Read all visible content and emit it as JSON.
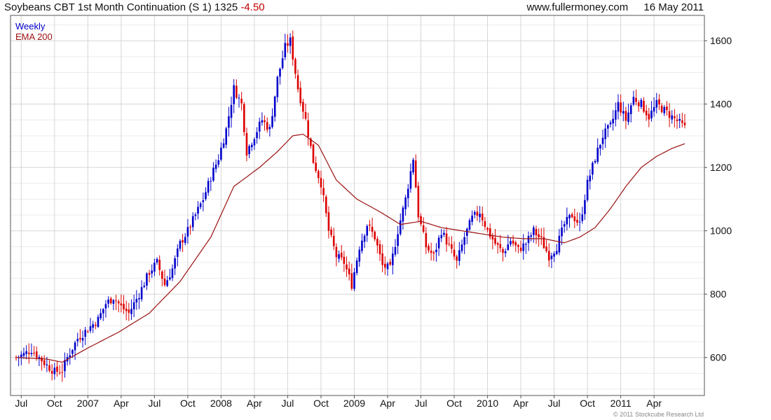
{
  "header": {
    "title": "Soybeans CBT 1st Month Continuation (S 1) 1325",
    "change": "-4.50",
    "site": "www.fullermoney.com",
    "date": "16 May 2011"
  },
  "footer": {
    "copyright": "© 2011 Stockcube Research Ltd"
  },
  "colors": {
    "up": "#0000cc",
    "down": "#dd0000",
    "ema": "#9b1010",
    "grid": "#d6d6d6",
    "grid_minor": "#ececec",
    "frame": "#555555"
  },
  "chart_data": {
    "type": "candlestick",
    "legend": [
      "Weekly",
      "EMA 200"
    ],
    "ylim": [
      480,
      1680
    ],
    "y_ticks": [
      600,
      800,
      1000,
      1200,
      1400,
      1600
    ],
    "x_ticks": [
      {
        "label": "Jul",
        "week": 2
      },
      {
        "label": "Oct",
        "week": 15
      },
      {
        "label": "2007",
        "week": 28
      },
      {
        "label": "Apr",
        "week": 41
      },
      {
        "label": "Jul",
        "week": 54
      },
      {
        "label": "Oct",
        "week": 67
      },
      {
        "label": "2008",
        "week": 80
      },
      {
        "label": "Apr",
        "week": 93
      },
      {
        "label": "Jul",
        "week": 106
      },
      {
        "label": "Oct",
        "week": 119
      },
      {
        "label": "2009",
        "week": 132
      },
      {
        "label": "Apr",
        "week": 145
      },
      {
        "label": "Jul",
        "week": 158
      },
      {
        "label": "Oct",
        "week": 171
      },
      {
        "label": "2010",
        "week": 184
      },
      {
        "label": "Apr",
        "week": 197
      },
      {
        "label": "Jul",
        "week": 210
      },
      {
        "label": "Oct",
        "week": 223
      },
      {
        "label": "2011",
        "week": 236
      },
      {
        "label": "Apr",
        "week": 249
      }
    ],
    "total_weeks": 262,
    "close_anchors": [
      [
        0,
        600
      ],
      [
        3,
        610
      ],
      [
        6,
        625
      ],
      [
        9,
        600
      ],
      [
        12,
        575
      ],
      [
        15,
        555
      ],
      [
        18,
        560
      ],
      [
        20,
        600
      ],
      [
        24,
        660
      ],
      [
        28,
        690
      ],
      [
        32,
        720
      ],
      [
        35,
        770
      ],
      [
        38,
        790
      ],
      [
        41,
        760
      ],
      [
        44,
        740
      ],
      [
        48,
        800
      ],
      [
        52,
        870
      ],
      [
        55,
        900
      ],
      [
        58,
        830
      ],
      [
        61,
        880
      ],
      [
        64,
        960
      ],
      [
        67,
        1000
      ],
      [
        70,
        1050
      ],
      [
        73,
        1100
      ],
      [
        76,
        1170
      ],
      [
        79,
        1230
      ],
      [
        82,
        1320
      ],
      [
        85,
        1450
      ],
      [
        88,
        1400
      ],
      [
        90,
        1250
      ],
      [
        93,
        1300
      ],
      [
        96,
        1350
      ],
      [
        99,
        1320
      ],
      [
        102,
        1480
      ],
      [
        105,
        1580
      ],
      [
        107,
        1600
      ],
      [
        110,
        1450
      ],
      [
        113,
        1350
      ],
      [
        116,
        1220
      ],
      [
        119,
        1150
      ],
      [
        122,
        1000
      ],
      [
        125,
        920
      ],
      [
        128,
        900
      ],
      [
        131,
        830
      ],
      [
        134,
        950
      ],
      [
        137,
        1020
      ],
      [
        140,
        980
      ],
      [
        143,
        890
      ],
      [
        146,
        880
      ],
      [
        149,
        1000
      ],
      [
        152,
        1100
      ],
      [
        155,
        1230
      ],
      [
        157,
        1050
      ],
      [
        160,
        950
      ],
      [
        163,
        920
      ],
      [
        166,
        1000
      ],
      [
        169,
        950
      ],
      [
        172,
        900
      ],
      [
        175,
        980
      ],
      [
        178,
        1040
      ],
      [
        181,
        1060
      ],
      [
        184,
        1000
      ],
      [
        187,
        960
      ],
      [
        190,
        930
      ],
      [
        193,
        970
      ],
      [
        196,
        940
      ],
      [
        199,
        960
      ],
      [
        202,
        1000
      ],
      [
        205,
        970
      ],
      [
        208,
        920
      ],
      [
        211,
        950
      ],
      [
        214,
        1020
      ],
      [
        217,
        1050
      ],
      [
        220,
        1020
      ],
      [
        223,
        1150
      ],
      [
        226,
        1230
      ],
      [
        229,
        1300
      ],
      [
        232,
        1330
      ],
      [
        235,
        1400
      ],
      [
        238,
        1350
      ],
      [
        241,
        1420
      ],
      [
        244,
        1400
      ],
      [
        247,
        1360
      ],
      [
        250,
        1400
      ],
      [
        253,
        1380
      ],
      [
        256,
        1360
      ],
      [
        259,
        1340
      ],
      [
        261,
        1325
      ]
    ],
    "ema_anchors": [
      [
        0,
        600
      ],
      [
        12,
        595
      ],
      [
        18,
        585
      ],
      [
        28,
        630
      ],
      [
        40,
        680
      ],
      [
        52,
        740
      ],
      [
        64,
        840
      ],
      [
        76,
        980
      ],
      [
        85,
        1140
      ],
      [
        95,
        1200
      ],
      [
        102,
        1250
      ],
      [
        108,
        1300
      ],
      [
        112,
        1305
      ],
      [
        118,
        1270
      ],
      [
        125,
        1160
      ],
      [
        133,
        1100
      ],
      [
        142,
        1060
      ],
      [
        150,
        1020
      ],
      [
        158,
        1030
      ],
      [
        166,
        1010
      ],
      [
        174,
        1000
      ],
      [
        182,
        990
      ],
      [
        190,
        980
      ],
      [
        198,
        975
      ],
      [
        206,
        975
      ],
      [
        214,
        962
      ],
      [
        220,
        980
      ],
      [
        226,
        1010
      ],
      [
        232,
        1070
      ],
      [
        238,
        1140
      ],
      [
        244,
        1200
      ],
      [
        250,
        1235
      ],
      [
        256,
        1260
      ],
      [
        261,
        1275
      ]
    ]
  }
}
